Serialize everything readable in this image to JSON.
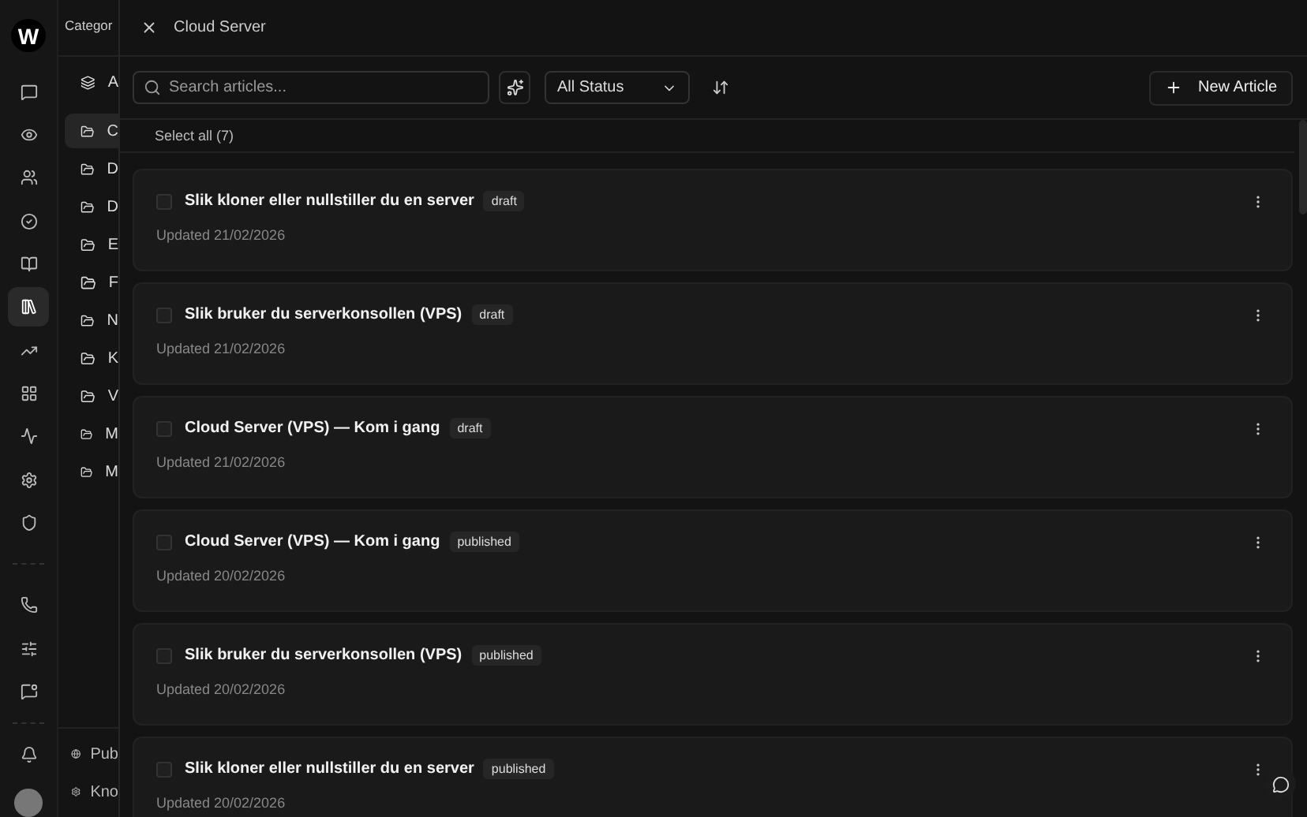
{
  "rail": {
    "logo": "W",
    "items": [
      {
        "selected": false
      },
      {
        "selected": false
      },
      {
        "selected": false
      },
      {
        "selected": false
      },
      {
        "selected": false
      },
      {
        "selected": true
      },
      {
        "selected": false
      },
      {
        "selected": false
      },
      {
        "selected": false
      },
      {
        "selected": false
      },
      {
        "selected": false
      }
    ],
    "bottom_items": [
      {
        "selected": false
      },
      {
        "selected": false
      },
      {
        "selected": false
      }
    ]
  },
  "categories": {
    "title": "Categor",
    "all": "A",
    "items": [
      {
        "label": "C",
        "selected": true
      },
      {
        "label": "D",
        "selected": false
      },
      {
        "label": "D",
        "selected": false
      },
      {
        "label": "E",
        "selected": false
      },
      {
        "label": "F",
        "selected": false
      },
      {
        "label": "N",
        "selected": false
      },
      {
        "label": "K",
        "selected": false
      },
      {
        "label": "V",
        "selected": false
      },
      {
        "label": "M",
        "selected": false
      },
      {
        "label": "M",
        "selected": false
      }
    ],
    "footer": [
      "Pub",
      "Kno"
    ]
  },
  "drawer": {
    "title": "Cloud Server",
    "search": {
      "placeholder": "Search articles..."
    },
    "status_filter": "All Status",
    "new_button": "New Article",
    "select_all": "Select all (7)",
    "articles": [
      {
        "title": "Slik kloner eller nullstiller du en server",
        "status": "draft",
        "updated": "Updated 21/02/2026",
        "checked": false
      },
      {
        "title": "Slik bruker du serverkonsollen (VPS)",
        "status": "draft",
        "updated": "Updated 21/02/2026",
        "checked": false
      },
      {
        "title": "Cloud Server (VPS) — Kom i gang",
        "status": "draft",
        "updated": "Updated 21/02/2026",
        "checked": false
      },
      {
        "title": "Cloud Server (VPS) — Kom i gang",
        "status": "published",
        "updated": "Updated 20/02/2026",
        "checked": false
      },
      {
        "title": "Slik bruker du serverkonsollen (VPS)",
        "status": "published",
        "updated": "Updated 20/02/2026",
        "checked": false
      },
      {
        "title": "Slik kloner eller nullstiller du en server",
        "status": "published",
        "updated": "Updated 20/02/2026",
        "checked": false
      }
    ]
  }
}
